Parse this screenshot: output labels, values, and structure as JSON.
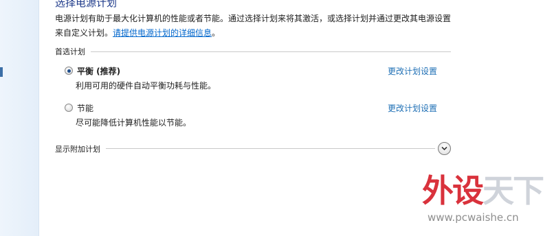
{
  "page": {
    "title": "选择电源计划",
    "description_line1": "电源计划有助于最大化计算机的性能或者节能。通过选择计划来将其激活，或选择计划并通过更改其电源设置",
    "description_line2_prefix": "来自定义计划。",
    "description_link": "请提供电源计划的详细信息",
    "description_line2_suffix": "。"
  },
  "preferred_section": {
    "label": "首选计划",
    "plans": [
      {
        "name": "平衡 (推荐)",
        "description": "利用可用的硬件自动平衡功耗与性能。",
        "change_link": "更改计划设置",
        "selected": true
      },
      {
        "name": "节能",
        "description": "尽可能降低计算机性能以节能。",
        "change_link": "更改计划设置",
        "selected": false
      }
    ]
  },
  "additional_section": {
    "label": "显示附加计划",
    "expand_icon": "chevron-down-icon"
  },
  "watermark": {
    "logo_part1": "外设",
    "logo_part2": "天下",
    "url": "www.pcwaishe.cn"
  },
  "colors": {
    "title": "#1e3a8a",
    "link": "#1e6fb5",
    "watermark_red": "#d9323c"
  }
}
